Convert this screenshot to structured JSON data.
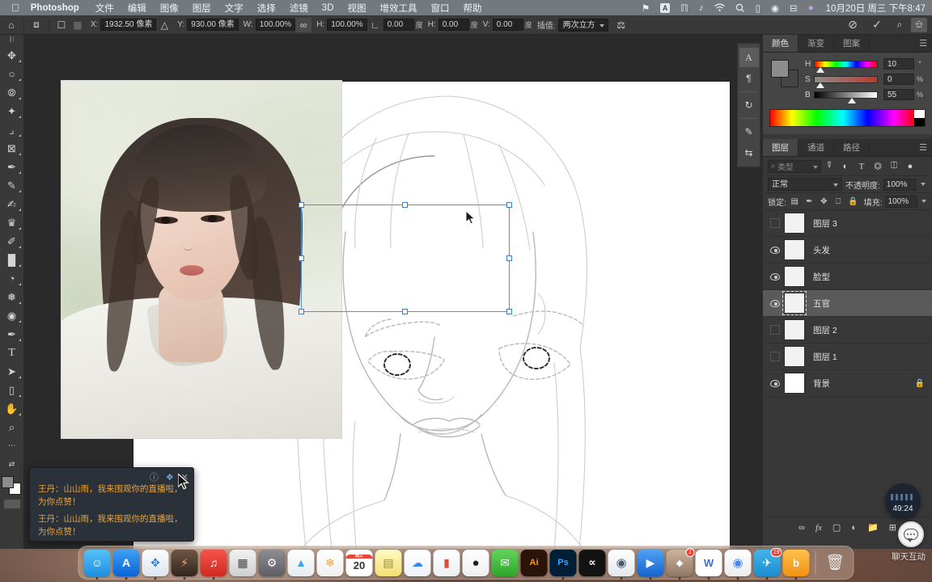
{
  "menubar": {
    "apple": "",
    "app_name": "Photoshop",
    "items": [
      "文件",
      "编辑",
      "图像",
      "图层",
      "文字",
      "选择",
      "滤镜",
      "3D",
      "视图",
      "增效工具",
      "窗口",
      "帮助"
    ],
    "status_icons": [
      "notification-bell-icon",
      "input-source-icon",
      "screen-share-icon",
      "bluetooth-icon",
      "wifi-icon",
      "search-icon",
      "display-icon",
      "control-center-icon",
      "airplay-icon",
      "siri-icon"
    ],
    "clock": "10月20日 周三 下午8:47"
  },
  "options_bar": {
    "home_icon": "home-icon",
    "transform_icon": "transform-reference-icon",
    "ref_point_icon": "reference-point-icon",
    "x_label": "X:",
    "x_value": "1932.50 像素",
    "delta_icon": "delta-icon",
    "y_label": "Y:",
    "y_value": "930.00 像素",
    "w_label": "W:",
    "w_value": "100.00%",
    "link_icon": "link-chain-icon",
    "h_label": "H:",
    "h_value": "100.00%",
    "angle_icon": "angle-icon",
    "angle_value": "0.00",
    "deg1": "度",
    "skew_h_label": "H:",
    "skew_h_value": "0.00",
    "deg2": "度",
    "skew_v_label": "V:",
    "skew_v_value": "0.00",
    "deg3": "度",
    "interp_label": "插值:",
    "interp_value": "两次立方",
    "warp_icon": "warp-icon",
    "cancel_icon": "cancel-transform-icon",
    "commit_icon": "commit-transform-icon",
    "arrange_icon": "arrange-documents-icon",
    "workspace_icon": "workspace-switcher-icon",
    "zoom_icon": "zoom-search-icon"
  },
  "toolbar": {
    "tools": [
      {
        "name": "move-tool",
        "glyph": "✥",
        "selected": false
      },
      {
        "name": "elliptical-marquee-tool",
        "glyph": "○",
        "selected": false
      },
      {
        "name": "lasso-tool",
        "glyph": "◌",
        "selected": false
      },
      {
        "name": "magic-wand-tool",
        "glyph": "✦",
        "selected": false
      },
      {
        "name": "crop-tool",
        "glyph": "⌗",
        "selected": false
      },
      {
        "name": "frame-tool",
        "glyph": "⊠",
        "selected": false
      },
      {
        "name": "eyedropper-tool",
        "glyph": "✐",
        "selected": false
      },
      {
        "name": "healing-brush-tool",
        "glyph": "✑",
        "selected": false
      },
      {
        "name": "brush-tool",
        "glyph": "✎",
        "selected": false
      },
      {
        "name": "clone-stamp-tool",
        "glyph": "♜",
        "selected": false
      },
      {
        "name": "history-brush-tool",
        "glyph": "✒",
        "selected": false
      },
      {
        "name": "eraser-tool",
        "glyph": "◨",
        "selected": false
      },
      {
        "name": "gradient-tool",
        "glyph": "◐",
        "selected": false
      },
      {
        "name": "blur-tool",
        "glyph": "◍",
        "selected": false
      },
      {
        "name": "dodge-tool",
        "glyph": "◎",
        "selected": false
      },
      {
        "name": "pen-tool",
        "glyph": "✒",
        "selected": false
      },
      {
        "name": "type-tool",
        "glyph": "T",
        "selected": false
      },
      {
        "name": "path-selection-tool",
        "glyph": "➤",
        "selected": false
      },
      {
        "name": "rectangle-tool",
        "glyph": "▭",
        "selected": false
      },
      {
        "name": "hand-tool",
        "glyph": "✋",
        "selected": false
      },
      {
        "name": "zoom-tool",
        "glyph": "⌕",
        "selected": false
      },
      {
        "name": "edit-toolbar-button",
        "glyph": "•••",
        "selected": false
      }
    ],
    "foreground_color": "#8c8c8c",
    "background_color": "#ffffff"
  },
  "right_rail": {
    "buttons": [
      {
        "name": "character-panel-icon",
        "glyph": "A",
        "active": true
      },
      {
        "name": "paragraph-panel-icon",
        "glyph": "¶",
        "active": false
      },
      {
        "name": "history-panel-icon",
        "glyph": "↻",
        "active": false
      },
      {
        "name": "brush-settings-panel-icon",
        "glyph": "✎",
        "active": false
      },
      {
        "name": "adjustments-panel-icon",
        "glyph": "⇄",
        "active": false
      }
    ],
    "detached_tab": {
      "name": "glyphs-panel-icon",
      "glyph": "A"
    }
  },
  "color_panel": {
    "tabs": [
      {
        "label": "颜色",
        "active": true
      },
      {
        "label": "渐变",
        "active": false
      },
      {
        "label": "图案",
        "active": false
      }
    ],
    "menu_icon": "panel-menu-icon",
    "sliders": [
      {
        "label": "H",
        "value": "10",
        "unit": "°",
        "knob_pct": 3
      },
      {
        "label": "S",
        "value": "0",
        "unit": "%",
        "knob_pct": 2
      },
      {
        "label": "B",
        "value": "55",
        "unit": "%",
        "knob_pct": 55
      }
    ],
    "foreground_color": "#8d8d8d",
    "background_color": "#454545"
  },
  "layers_panel": {
    "tabs": [
      {
        "label": "图层",
        "active": true
      },
      {
        "label": "通道",
        "active": false
      },
      {
        "label": "路径",
        "active": false
      }
    ],
    "menu_icon": "panel-menu-icon",
    "filter_placeholder": "类型",
    "filter_icons": [
      "filter-pixel-icon",
      "filter-adjustment-icon",
      "filter-type-icon",
      "filter-shape-icon",
      "filter-smart-object-icon",
      "filter-toggle-icon"
    ],
    "blend_mode": "正常",
    "opacity_label": "不透明度:",
    "opacity_value": "100%",
    "lock_label": "锁定:",
    "lock_icons": [
      "lock-transparent-pixels-icon",
      "lock-image-pixels-icon",
      "lock-position-icon",
      "lock-nesting-icon",
      "lock-all-icon"
    ],
    "fill_label": "填充:",
    "fill_value": "100%",
    "layers": [
      {
        "name": "图层 3",
        "visible": false,
        "selected": false,
        "locked": false,
        "thumb": "sketch"
      },
      {
        "name": "头发",
        "visible": true,
        "selected": false,
        "locked": false,
        "thumb": "sketch"
      },
      {
        "name": "脸型",
        "visible": true,
        "selected": false,
        "locked": false,
        "thumb": "sketch"
      },
      {
        "name": "五官",
        "visible": true,
        "selected": true,
        "locked": false,
        "thumb": "sketch"
      },
      {
        "name": "图层 2",
        "visible": false,
        "selected": false,
        "locked": false,
        "thumb": "sketch"
      },
      {
        "name": "图层 1",
        "visible": false,
        "selected": false,
        "locked": false,
        "thumb": "sketch"
      },
      {
        "name": "背景",
        "visible": true,
        "selected": false,
        "locked": true,
        "thumb": "white"
      }
    ],
    "footer_icons": [
      "link-layers-icon",
      "layer-style-icon",
      "layer-mask-icon",
      "adjustment-layer-icon",
      "new-group-icon",
      "new-layer-icon"
    ]
  },
  "chat_popup": {
    "help_icon": "help-icon",
    "pin_icon": "pin-icon",
    "close_icon": "close-icon",
    "messages": [
      "王丹：山山雨，我来围观你的直播啦，为你点赞！",
      "王丹：山山雨，我来围观你的直播啦，为你点赞！"
    ]
  },
  "live_overlay": {
    "timer": "49:24",
    "chat_button_icon": "chat-bubble-icon",
    "chat_label": "聊天互动"
  },
  "dock": {
    "items": [
      {
        "name": "finder",
        "glyph": "☺",
        "color": "#2e9bf0",
        "badge": null
      },
      {
        "name": "app-store",
        "glyph": "A",
        "color": "#1e7ce8",
        "badge": null
      },
      {
        "name": "safari",
        "glyph": "◉",
        "color": "#f1f4f8",
        "badge": null
      },
      {
        "name": "thunder-browser",
        "glyph": "⚡",
        "color": "#3f3733",
        "badge": null
      },
      {
        "name": "netease-music",
        "glyph": "♪",
        "color": "#e8352e",
        "badge": null
      },
      {
        "name": "calculator",
        "glyph": "▦",
        "color": "#e3e3e3",
        "badge": null
      },
      {
        "name": "system-preferences",
        "glyph": "⚙",
        "color": "#6e6e73",
        "badge": null
      },
      {
        "name": "image-viewer",
        "glyph": "◤",
        "color": "#f7f9fa",
        "badge": null
      },
      {
        "name": "photos",
        "glyph": "❀",
        "color": "#fbfbfb",
        "badge": null
      },
      {
        "name": "calendar",
        "glyph": "20",
        "color": "#ffffff",
        "badge": null
      },
      {
        "name": "notes",
        "glyph": "▤",
        "color": "#fcf0a8",
        "badge": null
      },
      {
        "name": "baidu-netdisk",
        "glyph": "☁",
        "color": "#f5f7fa",
        "badge": null
      },
      {
        "name": "wps-office",
        "glyph": "▮",
        "color": "#f4f5f7",
        "badge": null
      },
      {
        "name": "qq",
        "glyph": "🐧",
        "color": "#f7f7f7",
        "badge": null
      },
      {
        "name": "wechat",
        "glyph": "✆",
        "color": "#4ec04c",
        "badge": null
      },
      {
        "name": "illustrator",
        "glyph": "Ai",
        "color": "#2a1407",
        "badge": null
      },
      {
        "name": "photoshop",
        "glyph": "Ps",
        "color": "#001e36",
        "badge": null
      },
      {
        "name": "capcut",
        "glyph": "✂",
        "color": "#121212",
        "badge": null
      },
      {
        "name": "quicktime",
        "glyph": "Q",
        "color": "#f2f2f4",
        "badge": null
      },
      {
        "name": "video-player",
        "glyph": "▶",
        "color": "#1f6fe0",
        "badge": null
      },
      {
        "name": "live-streaming-app",
        "glyph": "◆",
        "color": "#b9a38f",
        "badge": "1"
      },
      {
        "name": "uu-app",
        "glyph": "W",
        "color": "#fdfdfd",
        "badge": null
      },
      {
        "name": "chrome",
        "glyph": "◎",
        "color": "#f6f6f6",
        "badge": null
      },
      {
        "name": "telegram",
        "glyph": "✈",
        "color": "#2ea6e0",
        "badge": "19"
      },
      {
        "name": "douban-app",
        "glyph": "b",
        "color": "#f5a623",
        "badge": null
      }
    ],
    "trash_icon": "trash-icon"
  }
}
